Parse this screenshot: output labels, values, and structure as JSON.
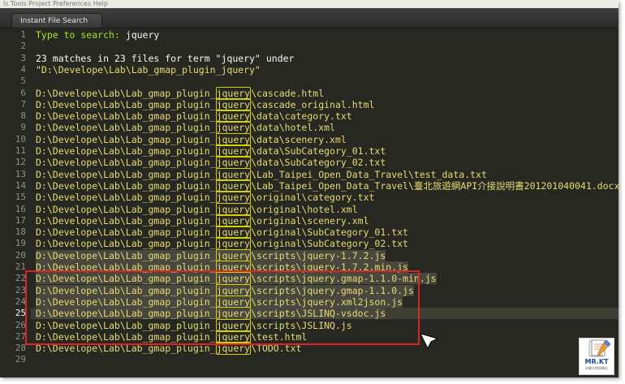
{
  "window": {
    "menu_fragment": "ls  Tools  Project  Preferences  Help"
  },
  "tab": {
    "title": "Instant File Search"
  },
  "search": {
    "prompt": "Type to search: ",
    "term": "jquery",
    "summary": "23 matches in 23 files for term \"jquery\" under",
    "root": "\"D:\\Develope\\Lab\\Lab_gmap_plugin_jquery\""
  },
  "results": [
    {
      "line": "6",
      "prefix": "D:\\Develope\\Lab\\Lab_gmap_plugin_",
      "match": "jquery",
      "suffix": "\\cascade.html"
    },
    {
      "line": "7",
      "prefix": "D:\\Develope\\Lab\\Lab_gmap_plugin_",
      "match": "jquery",
      "suffix": "\\cascade_original.html"
    },
    {
      "line": "8",
      "prefix": "D:\\Develope\\Lab\\Lab_gmap_plugin_",
      "match": "jquery",
      "suffix": "\\data\\category.txt"
    },
    {
      "line": "9",
      "prefix": "D:\\Develope\\Lab\\Lab_gmap_plugin_",
      "match": "jquery",
      "suffix": "\\data\\hotel.xml"
    },
    {
      "line": "10",
      "prefix": "D:\\Develope\\Lab\\Lab_gmap_plugin_",
      "match": "jquery",
      "suffix": "\\data\\scenery.xml"
    },
    {
      "line": "11",
      "prefix": "D:\\Develope\\Lab\\Lab_gmap_plugin_",
      "match": "jquery",
      "suffix": "\\data\\SubCategory_01.txt"
    },
    {
      "line": "12",
      "prefix": "D:\\Develope\\Lab\\Lab_gmap_plugin_",
      "match": "jquery",
      "suffix": "\\data\\SubCategory_02.txt"
    },
    {
      "line": "13",
      "prefix": "D:\\Develope\\Lab\\Lab_gmap_plugin_",
      "match": "jquery",
      "suffix": "\\Lab_Taipei_Open_Data_Travel\\test_data.txt"
    },
    {
      "line": "14",
      "prefix": "D:\\Develope\\Lab\\Lab_gmap_plugin_",
      "match": "jquery",
      "suffix": "\\Lab_Taipei_Open_Data_Travel\\臺北旅遊網API介接說明書201201040041.docx"
    },
    {
      "line": "15",
      "prefix": "D:\\Develope\\Lab\\Lab_gmap_plugin_",
      "match": "jquery",
      "suffix": "\\original\\category.txt"
    },
    {
      "line": "16",
      "prefix": "D:\\Develope\\Lab\\Lab_gmap_plugin_",
      "match": "jquery",
      "suffix": "\\original\\hotel.xml"
    },
    {
      "line": "17",
      "prefix": "D:\\Develope\\Lab\\Lab_gmap_plugin_",
      "match": "jquery",
      "suffix": "\\original\\scenery.xml"
    },
    {
      "line": "18",
      "prefix": "D:\\Develope\\Lab\\Lab_gmap_plugin_",
      "match": "jquery",
      "suffix": "\\original\\SubCategory_01.txt"
    },
    {
      "line": "19",
      "prefix": "D:\\Develope\\Lab\\Lab_gmap_plugin_",
      "match": "jquery",
      "suffix": "\\original\\SubCategory_02.txt"
    },
    {
      "line": "20",
      "prefix": "D:\\Develope\\Lab\\Lab_gmap_plugin_",
      "match": "jquery",
      "suffix": "\\scripts\\jquery-1.7.2.js"
    },
    {
      "line": "21",
      "prefix": "D:\\Develope\\Lab\\Lab_gmap_plugin_",
      "match": "jquery",
      "suffix": "\\scripts\\jquery-1.7.2.min.js"
    },
    {
      "line": "22",
      "prefix": "D:\\Develope\\Lab\\Lab_gmap_plugin_",
      "match": "jquery",
      "suffix": "\\scripts\\jquery.gmap-1.1.0-min.js"
    },
    {
      "line": "23",
      "prefix": "D:\\Develope\\Lab\\Lab_gmap_plugin_",
      "match": "jquery",
      "suffix": "\\scripts\\jquery.gmap-1.1.0.js"
    },
    {
      "line": "24",
      "prefix": "D:\\Develope\\Lab\\Lab_gmap_plugin_",
      "match": "jquery",
      "suffix": "\\scripts\\jquery.xml2json.js"
    },
    {
      "line": "25",
      "prefix": "D:\\Develope\\Lab\\Lab_gmap_plugin_",
      "match": "jquery",
      "suffix": "\\scripts\\JSLINQ-vsdoc.js"
    },
    {
      "line": "26",
      "prefix": "D:\\Develope\\Lab\\Lab_gmap_plugin_",
      "match": "jquery",
      "suffix": "\\scripts\\JSLINQ.js"
    },
    {
      "line": "27",
      "prefix": "D:\\Develope\\Lab\\Lab_gmap_plugin_",
      "match": "jquery",
      "suffix": "\\test.html"
    },
    {
      "line": "28",
      "prefix": "D:\\Develope\\Lab\\Lab_gmap_plugin_",
      "match": "jquery",
      "suffix": "\\TODO.txt"
    }
  ],
  "header_lines": [
    "1",
    "2",
    "3",
    "4",
    "5"
  ],
  "last_line": "29",
  "selected_lines": [
    "20",
    "21",
    "22",
    "23",
    "24",
    "25"
  ],
  "current_line": "25",
  "watermark": {
    "brand": "MR.KT",
    "tagline": "封機式學習筆記"
  },
  "colors": {
    "editor_bg": "#272822",
    "prompt_green": "#a6e22e",
    "path_yellow": "#e6db74",
    "match_outline": "#d6d000",
    "annotation_red": "#e02222"
  },
  "icons": [
    "mouse-cursor-icon",
    "mrkt-logo-icon"
  ]
}
